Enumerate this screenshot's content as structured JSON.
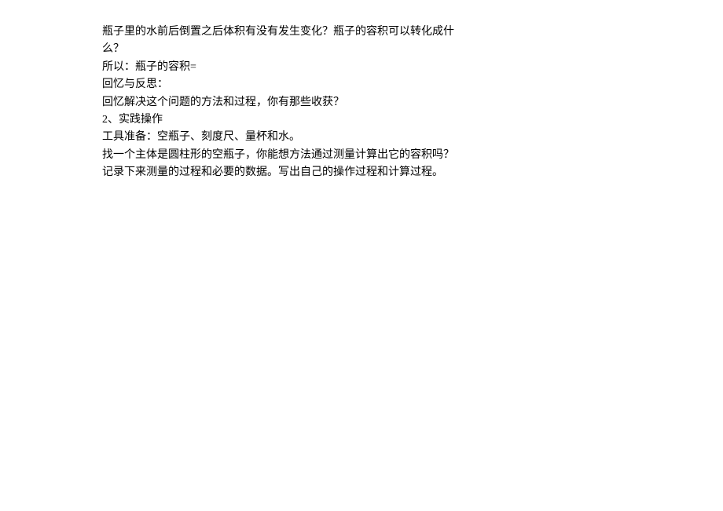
{
  "lines": [
    "瓶子里的水前后倒置之后体积有没有发生变化？瓶子的容积可以转化成什",
    "么？",
    "所以：瓶子的容积=",
    "回忆与反思：",
    "回忆解决这个问题的方法和过程，你有那些收获？",
    "2、实践操作",
    "工具准备：空瓶子、刻度尺、量杯和水。",
    "找一个主体是圆柱形的空瓶子，你能想方法通过测量计算出它的容积吗？",
    "记录下来测量的过程和必要的数据。写出自己的操作过程和计算过程。"
  ]
}
